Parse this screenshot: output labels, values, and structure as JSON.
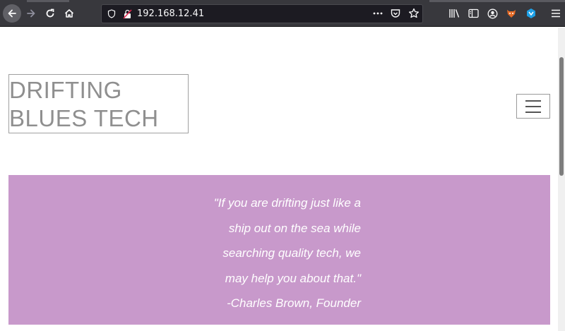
{
  "browser": {
    "url": "192.168.12.41",
    "icons": {
      "back": "back-arrow-icon",
      "forward": "forward-arrow-icon",
      "reload": "reload-icon",
      "home": "home-icon",
      "tracking": "tracking-protection-icon",
      "insecure": "insecure-connection-icon",
      "page_actions": "more-actions-icon",
      "pocket": "pocket-icon",
      "bookmark": "bookmark-star-icon",
      "library": "library-icon",
      "sidebar": "sidebar-icon",
      "account": "account-icon",
      "ext_fox": "foxyproxy-extension-icon",
      "ext_cube": "wappalyzer-extension-icon",
      "menu": "hamburger-menu-icon"
    }
  },
  "page": {
    "brand_title": "DRIFTING\nBLUES TECH",
    "hero_color": "#c899cb",
    "quote_lines": [
      "\"If you are drifting just like a",
      "ship out on the sea while",
      "searching quality tech, we",
      "may help you about that.\"",
      "-Charles Brown, Founder"
    ]
  }
}
